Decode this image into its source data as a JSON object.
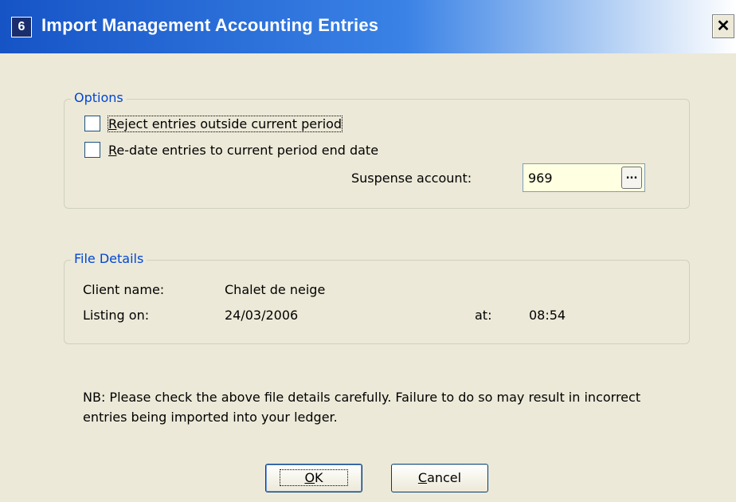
{
  "window": {
    "icon_text": "6",
    "title": "Import Management Accounting Entries",
    "close_symbol": "✕"
  },
  "options": {
    "legend": "Options",
    "reject_label_first": "R",
    "reject_label_rest": "eject entries outside current period",
    "reject_checked": false,
    "redate_label_first": "R",
    "redate_label_rest": "e-date entries to current period end date",
    "redate_checked": false,
    "suspense_label": "Suspense account:",
    "suspense_value": "969",
    "lookup_label": "..."
  },
  "file_details": {
    "legend": "File Details",
    "client_label": "Client name:",
    "client_value": "Chalet de neige",
    "listing_label": "Listing on:",
    "listing_date": "24/03/2006",
    "at_label": "at:",
    "listing_time": "08:54"
  },
  "note": "NB: Please check the above file details carefully. Failure to do so may result in incorrect entries being imported into your ledger.",
  "buttons": {
    "ok_first": "O",
    "ok_rest": "K",
    "cancel_first": "C",
    "cancel_rest": "ancel"
  }
}
